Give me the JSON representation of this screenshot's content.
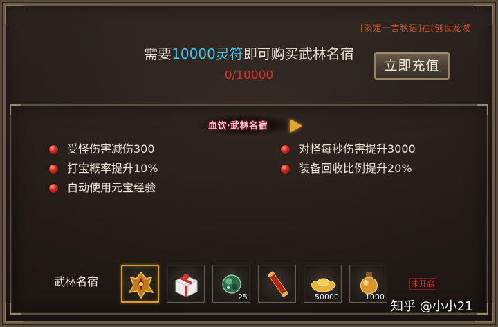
{
  "ticker": "[淡定一言秋语]在[创世龙域",
  "purchase": {
    "prefix": "需要",
    "amount": "10000灵符",
    "suffix": "即可购买武林名宿",
    "progress": "0/10000"
  },
  "recharge_button": "立即充值",
  "title": "血饮·武林名宿",
  "attributes_left": [
    "受怪伤害减伤300",
    "打宝概率提升10%",
    "自动使用元宝经验"
  ],
  "attributes_right": [
    "对怪每秒伤害提升3000",
    "装备回收比例提升20%"
  ],
  "slot_label": "武林名宿",
  "items": [
    {
      "icon": "golden-helmet-icon",
      "qty": ""
    },
    {
      "icon": "gift-box-icon",
      "qty": ""
    },
    {
      "icon": "jade-orb-icon",
      "qty": "25"
    },
    {
      "icon": "red-scroll-icon",
      "qty": ""
    },
    {
      "icon": "gold-ingot-icon",
      "qty": "50000"
    },
    {
      "icon": "potion-flask-icon",
      "qty": "1000"
    }
  ],
  "status": "未开启",
  "watermark": "知乎 @小小21",
  "colors": {
    "highlight": "#3fc7ee",
    "progress": "#d9312a",
    "ticker": "#c0562a",
    "selected_border": "#d99a2e"
  }
}
